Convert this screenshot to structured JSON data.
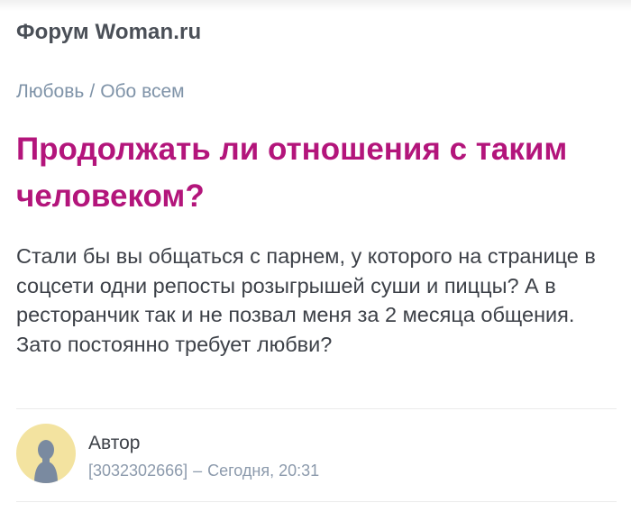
{
  "header": {
    "site_title": "Форум Woman.ru"
  },
  "breadcrumb": {
    "items": [
      "Любовь",
      "Обо всем"
    ],
    "separator": "/"
  },
  "topic": {
    "title": "Продолжать ли отношения с таким человеком?",
    "body": "Стали бы вы общаться с парнем, у которого на странице в соцсети одни репосты розыгрышей суши и пиццы? А в ресторанчик так и не позвал меня за 2 месяца общения. Зато постоянно требует любви?"
  },
  "author": {
    "name": "Автор",
    "id": "[3032302666]",
    "separator": "–",
    "timestamp": "Сегодня, 20:31",
    "avatar_icon": "user-silhouette-icon"
  },
  "colors": {
    "title": "#b3157b",
    "breadcrumb": "#7f93a8",
    "text": "#3d4148",
    "meta": "#8c9aac",
    "avatar_bg": "#f3e3a0",
    "avatar_figure": "#7a8aa0"
  }
}
